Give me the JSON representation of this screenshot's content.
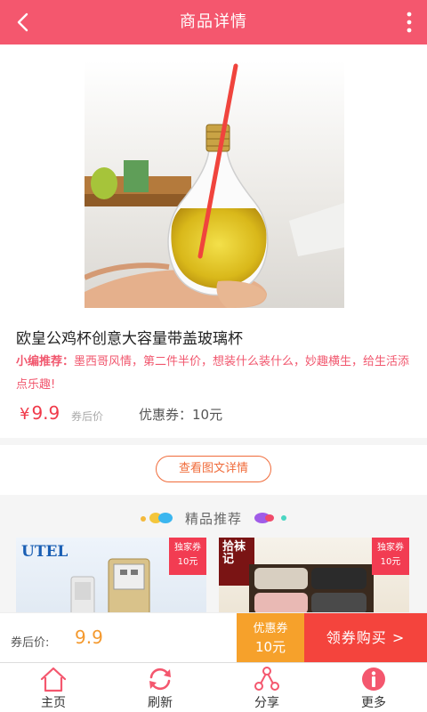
{
  "header": {
    "title": "商品详情",
    "back_icon": "chevron-left-icon",
    "more_icon": "vertical-dots-icon"
  },
  "product": {
    "image": "glass-bulb-cup-photo",
    "name": "欧皇公鸡杯创意大容量带盖玻璃杯",
    "recommend_label": "小编推荐：",
    "recommend_text": "墨西哥风情，第二件半价，想装什么装什么，妙趣横生，给生活添点乐趣!",
    "price_symbol": "¥",
    "price": "9.9",
    "after_label": "券后价",
    "coupon_label": "优惠券：",
    "coupon_value": "10元"
  },
  "detail_button": {
    "label": "查看图文详情"
  },
  "recommend_section": {
    "title": "精品推荐",
    "items": [
      {
        "brand": "UTEL",
        "badge_line1": "独家券",
        "badge_line2": "10元"
      },
      {
        "brand": "拾袜记",
        "badge_line1": "独家券",
        "badge_line2": "10元"
      }
    ]
  },
  "buybar": {
    "after_label": "券后价:",
    "after_value": "9.9",
    "coupon_line1": "优惠券",
    "coupon_line2": "10元",
    "buy_label": "领券购买 >"
  },
  "tabbar": [
    {
      "label": "主页",
      "icon": "home-icon"
    },
    {
      "label": "刷新",
      "icon": "refresh-icon"
    },
    {
      "label": "分享",
      "icon": "share-icon"
    },
    {
      "label": "更多",
      "icon": "info-icon"
    }
  ],
  "colors": {
    "accent": "#f4576e",
    "price": "#f03a4a",
    "coupon": "#f6a12b",
    "buy": "#f4443d",
    "detail_btn": "#f06b3a"
  }
}
